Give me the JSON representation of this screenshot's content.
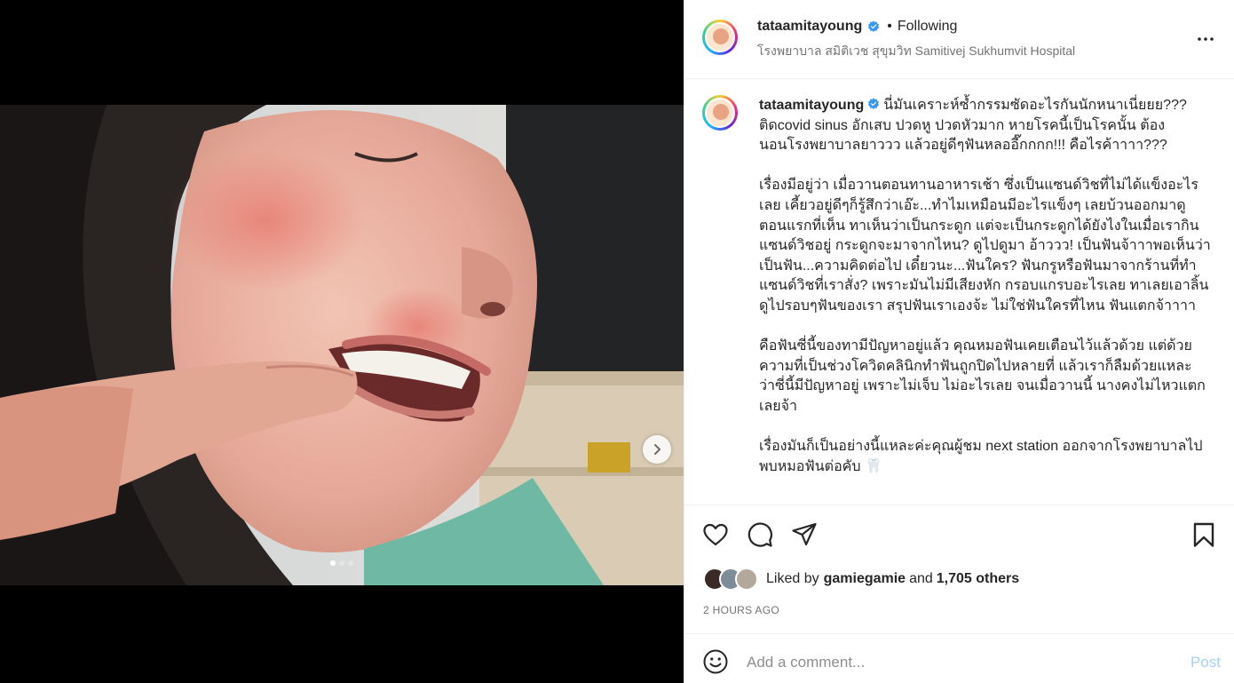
{
  "post": {
    "username": "tataamitayoung",
    "follow_separator": "•",
    "follow_label": "Following",
    "location": "โรงพยาบาล สมิติเวช สุขุมวิท Samitivej Sukhumvit Hospital",
    "verified": true
  },
  "caption": {
    "username": "tataamitayoung",
    "paragraphs": [
      "นี่มันเคราะห์ซ้ำกรรมซัดอะไรกันนักหนาเนี่ยยย??? ติดcovid sinus อักเสบ ปวดหู ปวดหัวมาก หายโรคนี้เป็นโรคนั้น ต้องนอนโรงพยาบาลยาววว แล้วอยู่ดีๆฟันหลออี๊กกกก!!! คือไรค้าาาา???",
      "เรื่องมีอยู่ว่า เมื่อวานตอนทานอาหารเช้า ซึ่งเป็นแซนด์วิชที่ไม่ได้แข็งอะไรเลย เคี้ยวอยู่ดีๆก็รู้สึกว่าเอ๊ะ...ทำไมเหมือนมีอะไรแข็งๆ เลยบ้วนออกมาดู ตอนแรกที่เห็น ทาเห็นว่าเป็นกระดูก แต่จะเป็นกระดูกได้ยังไงในเมื่อเรากินแซนด์วิชอยู่ กระดูกจะมาจากไหน? ดูไปดูมา อ้าววว! เป็นฟันจ้าาาพอเห็นว่าเป็นฟัน...ความคิดต่อไป เดี๋ยวนะ...ฟันใคร? ฟันกรูหรือฟันมาจากร้านที่ทำแซนด์วิชที่เราสั่ง? เพราะมันไม่มีเสียงหัก กรอบแกรบอะไรเลย ทาเลยเอาลิ้นดูไปรอบๆฟันของเรา สรุปฟันเราเองจ้ะ ไม่ใช่ฟันใครที่ไหน ฟันแตกจ้าาาา",
      "คือฟันซี่นี้ของทามีปัญหาอยู่แล้ว คุณหมอฟันเคยเตือนไว้แล้วด้วย แต่ด้วยความที่เป็นช่วงโควิดคลินิกทำฟันถูกปิดไปหลายที่ แล้วเราก็ลืมด้วยแหละ ว่าซี่นี้มีปัญหาอยู่ เพราะไม่เจ็บ ไม่อะไรเลย จนเมื่อวานนี้ นางคงไม่ไหวแตกเลยจ้า",
      "เรื่องมันก็เป็นอย่างนี้แหละค่ะคุณผู้ชม next station ออกจากโรงพยาบาลไปพบหมอฟันต่อคับ 🦷"
    ]
  },
  "media": {
    "slide_count": 3,
    "active_slide": 1,
    "next_icon": "chevron-right-icon"
  },
  "actions": {
    "like_icon": "heart-icon",
    "comment_icon": "comment-icon",
    "share_icon": "share-icon",
    "save_icon": "bookmark-icon"
  },
  "likes": {
    "prefix": "Liked by",
    "user": "gamiegamie",
    "joiner": "and",
    "others": "1,705 others"
  },
  "timestamp": "2 HOURS AGO",
  "comment": {
    "placeholder": "Add a comment...",
    "post_label": "Post",
    "emoji_icon": "emoji-icon"
  },
  "colors": {
    "verified": "#3897f0",
    "post_button_disabled": "#a7d1f9",
    "secondary_text": "#737373"
  }
}
